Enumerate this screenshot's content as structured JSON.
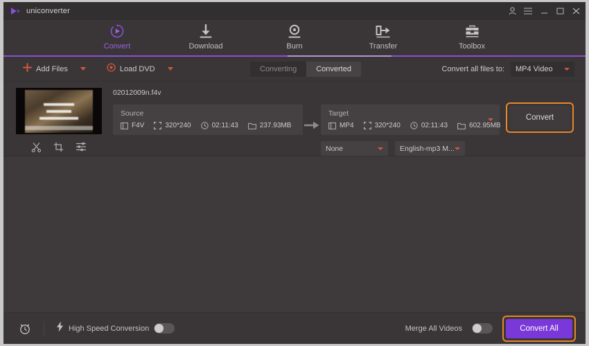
{
  "app": {
    "brand": "uniconverter",
    "brand_logo_icon": "play-triangle-logo-icon",
    "accent_purple": "#8a4fd4",
    "accent_orange": "#e8862a",
    "accent_red": "#d4553c",
    "window_bg": "#3e3a3b"
  },
  "titlebar": {
    "controls": [
      {
        "name": "account-icon",
        "glyph": "⚹"
      },
      {
        "name": "menu-icon",
        "glyph": "≡"
      },
      {
        "name": "minimize-icon",
        "glyph": "–"
      },
      {
        "name": "maximize-icon",
        "glyph": "☐"
      },
      {
        "name": "close-icon",
        "glyph": "✕"
      }
    ]
  },
  "nav": {
    "items": [
      {
        "label": "Convert",
        "icon": "convert-circular-play-icon",
        "active": true
      },
      {
        "label": "Download",
        "icon": "download-arrow-icon",
        "active": false
      },
      {
        "label": "Burn",
        "icon": "burn-disc-icon",
        "active": false
      },
      {
        "label": "Transfer",
        "icon": "transfer-device-icon",
        "active": false
      },
      {
        "label": "Toolbox",
        "icon": "toolbox-icon",
        "active": false
      }
    ]
  },
  "toolbar": {
    "add_files_label": "Add Files",
    "add_files_icon": "plus-icon",
    "load_dvd_label": "Load DVD",
    "load_dvd_icon": "disc-icon",
    "tabs": [
      {
        "label": "Converting",
        "active": false
      },
      {
        "label": "Converted",
        "active": true
      }
    ],
    "convert_all_to_label": "Convert all files to:",
    "convert_all_to_value": "MP4 Video"
  },
  "file": {
    "name": "02012009n.f4v",
    "thumbnail_icon": "video-thumbnail",
    "tools": [
      {
        "name": "trim-scissors-icon"
      },
      {
        "name": "crop-icon"
      },
      {
        "name": "effects-sliders-icon"
      }
    ],
    "source": {
      "title": "Source",
      "format": "F4V",
      "resolution": "320*240",
      "duration": "02:11:43",
      "size": "237.93MB"
    },
    "target": {
      "title": "Target",
      "format": "MP4",
      "resolution": "320*240",
      "duration": "02:11:43",
      "size": "602.95MB"
    },
    "subtitle_select": "None",
    "audio_select": "English-mp3 M...",
    "convert_button": "Convert"
  },
  "footer": {
    "alarm_icon": "alarm-clock-icon",
    "high_speed_icon": "lightning-bolt-icon",
    "high_speed_label": "High Speed Conversion",
    "high_speed_on": false,
    "merge_label": "Merge All Videos",
    "merge_on": false,
    "convert_all_button": "Convert All"
  }
}
